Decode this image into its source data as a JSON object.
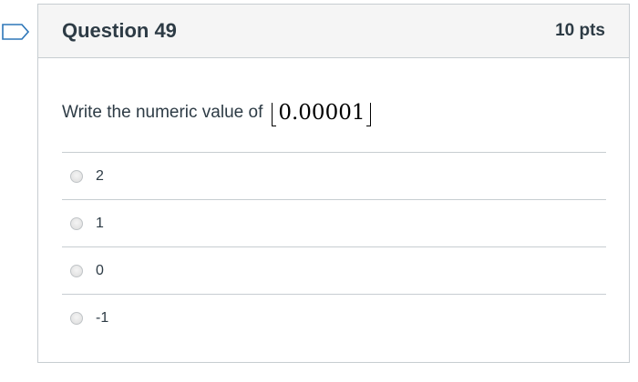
{
  "question": {
    "title": "Question 49",
    "points": "10 pts",
    "prompt": "Write the numeric value of",
    "math_expression": "0.00001",
    "answers": [
      {
        "label": "2"
      },
      {
        "label": "1"
      },
      {
        "label": "0"
      },
      {
        "label": "-1"
      }
    ]
  },
  "colors": {
    "header_bg": "#f5f5f5",
    "border": "#c7cdd1",
    "text": "#2d3b45",
    "flag_outline": "#2d76b8"
  },
  "icons": {
    "flag": "bookmark-flag-icon"
  }
}
